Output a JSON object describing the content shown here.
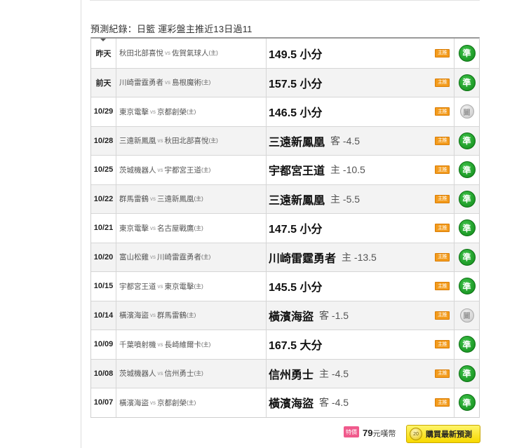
{
  "record": {
    "title": "預測紀錄：",
    "expert": "日籃",
    "summary": "運彩盤主推近13日過11"
  },
  "rows": [
    {
      "date": "昨天",
      "away": "秋田北部喜悅",
      "home": "佐賀氣球人",
      "pick": "149.5 小分",
      "line": "",
      "result": "準"
    },
    {
      "date": "前天",
      "away": "川崎雷霆勇者",
      "home": "島根魔術",
      "pick": "157.5 小分",
      "line": "",
      "result": "準"
    },
    {
      "date": "10/29",
      "away": "東京電擊",
      "home": "京都創榮",
      "pick": "146.5 小分",
      "line": "",
      "result": "闔"
    },
    {
      "date": "10/28",
      "away": "三遠新鳳凰",
      "home": "秋田北部喜悅",
      "pick": "三遠新鳳凰",
      "line": "客 -4.5",
      "result": "準"
    },
    {
      "date": "10/25",
      "away": "茨城機器人",
      "home": "宇都宮王道",
      "pick": "宇都宮王道",
      "line": "主 -10.5",
      "result": "準"
    },
    {
      "date": "10/22",
      "away": "群馬雷鶴",
      "home": "三遠新鳳凰",
      "pick": "三遠新鳳凰",
      "line": "主 -5.5",
      "result": "準"
    },
    {
      "date": "10/21",
      "away": "東京電擊",
      "home": "名古屋戰鷹",
      "pick": "147.5 小分",
      "line": "",
      "result": "準"
    },
    {
      "date": "10/20",
      "away": "富山松雞",
      "home": "川崎雷霆勇者",
      "pick": "川崎雷霆勇者",
      "line": "主 -13.5",
      "result": "準"
    },
    {
      "date": "10/15",
      "away": "宇都宮王道",
      "home": "東京電擊",
      "pick": "145.5 小分",
      "line": "",
      "result": "準"
    },
    {
      "date": "10/14",
      "away": "橫濱海盜",
      "home": "群馬雷鶴",
      "pick": "橫濱海盜",
      "line": "客 -1.5",
      "result": "闔"
    },
    {
      "date": "10/09",
      "away": "千葉噴射機",
      "home": "長崎維爾卡",
      "pick": "167.5 大分",
      "line": "",
      "result": "準"
    },
    {
      "date": "10/08",
      "away": "茨城機器人",
      "home": "信州勇士",
      "pick": "信州勇士",
      "line": "主 -4.5",
      "result": "準"
    },
    {
      "date": "10/07",
      "away": "橫濱海盜",
      "home": "京都創榮",
      "pick": "橫濱海盜",
      "line": "客 -4.5",
      "result": "準"
    }
  ],
  "labels": {
    "vs": "vs",
    "home_mark": "(主)",
    "badge": "主推"
  },
  "footer": {
    "price_tag": "特價",
    "price": "79",
    "price_unit": "元嘆幣",
    "buy_icon_text": "20",
    "buy_label": "購買最新預測"
  },
  "colors": {
    "win_green": "#0f8a18",
    "badge_orange": "#f39b1c",
    "buy_yellow": "#f7d800",
    "price_pink": "#f05a8c"
  }
}
